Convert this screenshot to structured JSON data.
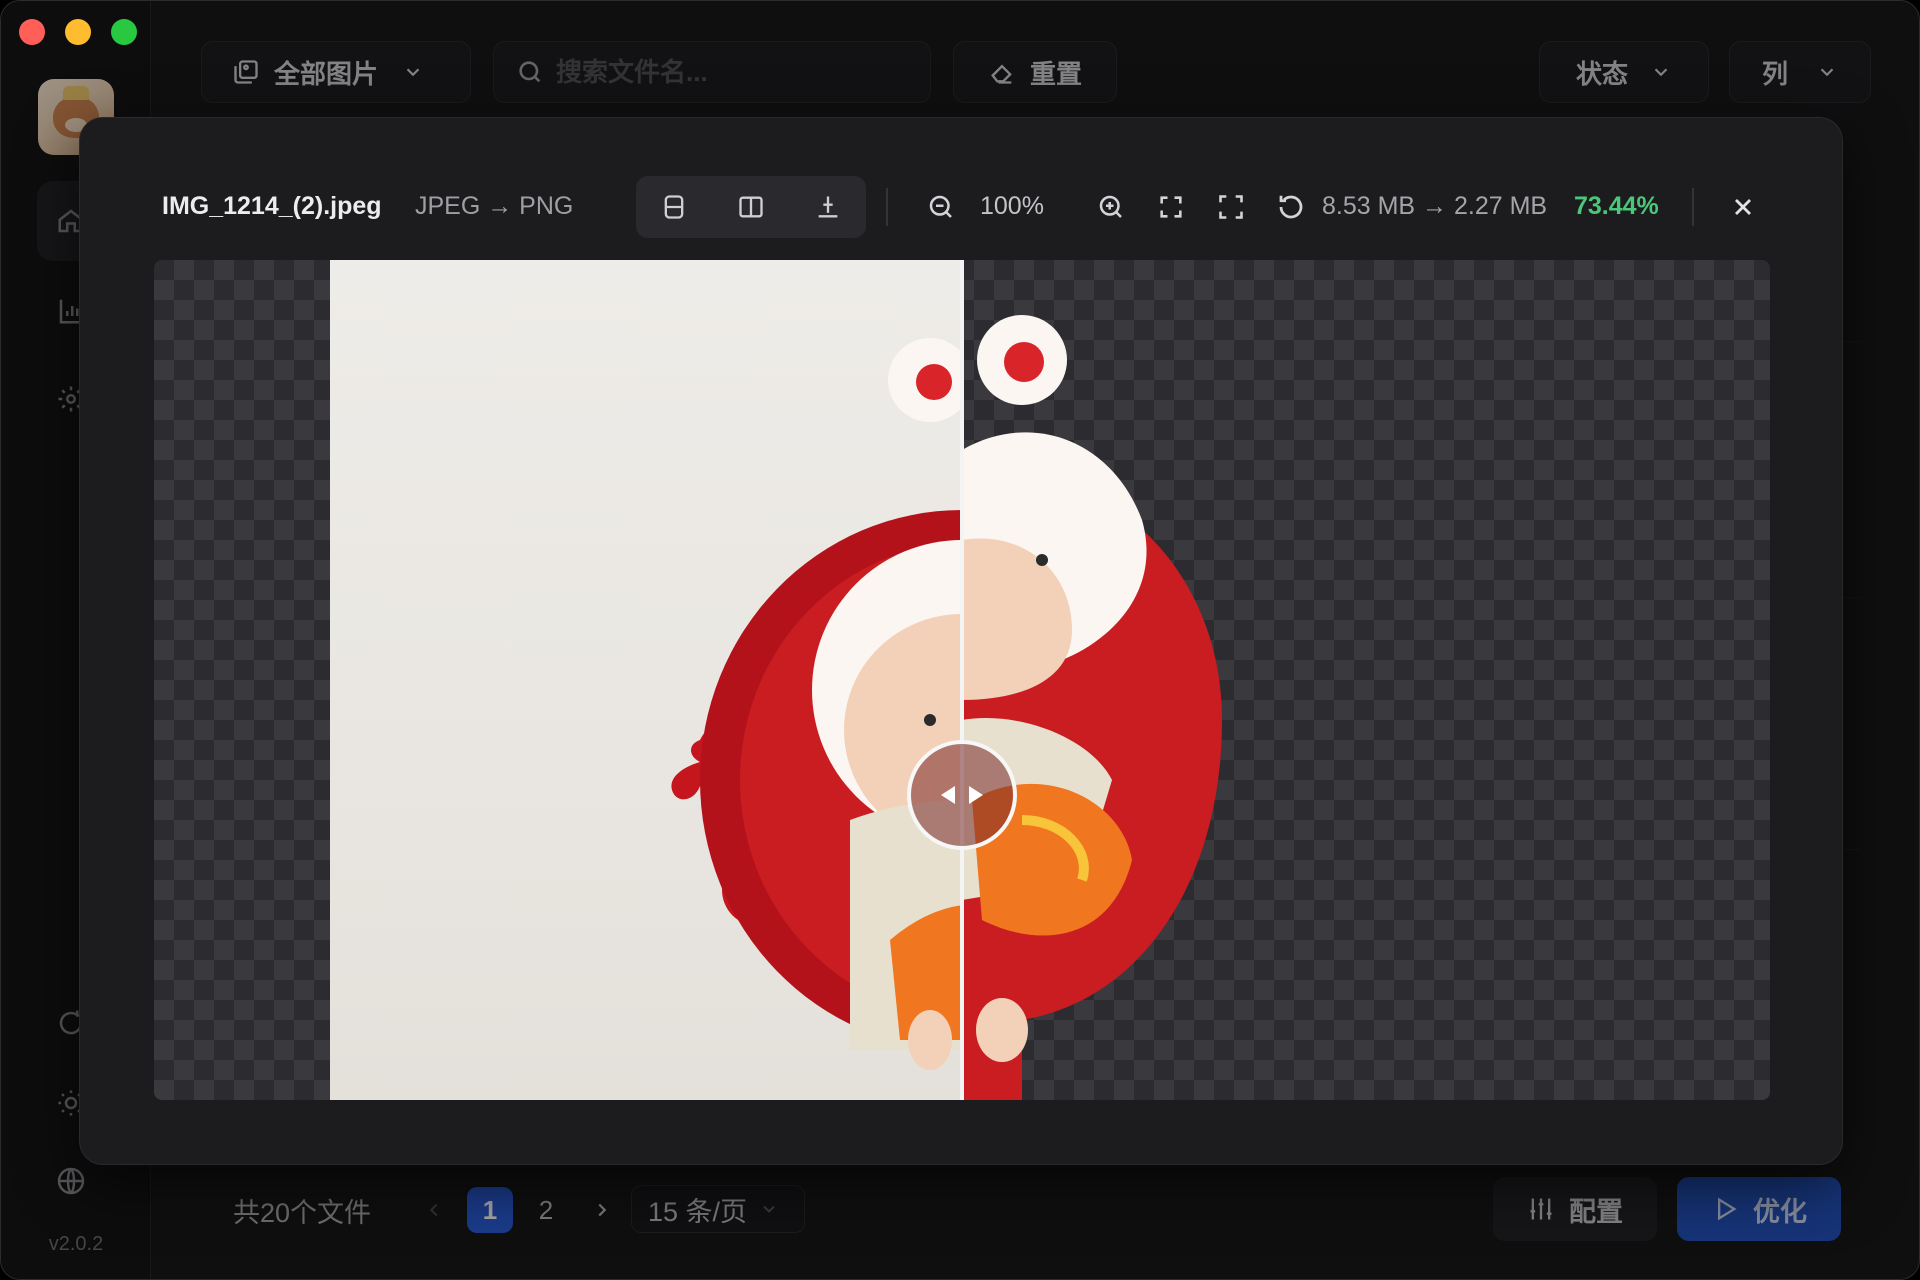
{
  "app": {
    "version": "v2.0.2",
    "colors": {
      "accent": "#2a5cd6",
      "savings_green": "#4bc77a",
      "window_bg": "#17171a"
    }
  },
  "sidebar": {
    "items": [
      {
        "icon": "home-icon"
      },
      {
        "icon": "chart-icon"
      },
      {
        "icon": "settings-icon"
      },
      {
        "icon": "sync-icon"
      },
      {
        "icon": "sun-icon"
      },
      {
        "icon": "globe-icon"
      }
    ]
  },
  "toolbar": {
    "filter_label": "全部图片",
    "search_placeholder": "搜索文件名...",
    "reset_label": "重置",
    "status_label": "状态",
    "columns_label": "列"
  },
  "footer": {
    "count_label": "共20个文件",
    "pages": [
      "1",
      "2"
    ],
    "current_page": "1",
    "page_size_label": "15 条/页",
    "config_label": "配置",
    "optimize_label": "优化"
  },
  "preview": {
    "filename": "IMG_1214_(2).jpeg",
    "format_change": "JPEG → PNG",
    "view_modes": [
      "split-vertical-icon",
      "split-side-by-side-icon",
      "split-horizontal-icon"
    ],
    "zoom": "100%",
    "size_change": "8.53 MB → 2.27 MB",
    "ratio": "73.44%",
    "compare_position": 0.5
  }
}
